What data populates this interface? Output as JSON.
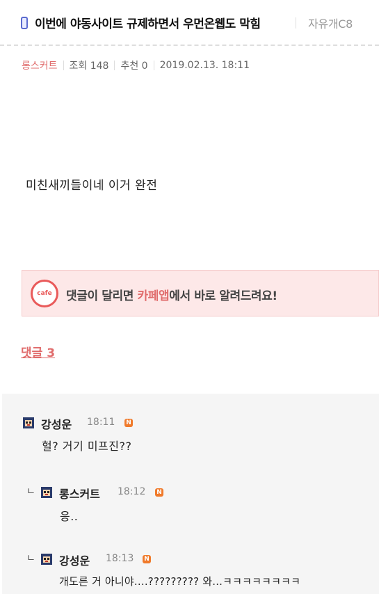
{
  "post": {
    "title": "이번에 야동사이트 규제하면서 우먼온웹도 막힘",
    "board": "자유개C8",
    "author": "롱스커트",
    "views": "조회 148",
    "likes": "추천 0",
    "date": "2019.02.13. 18:11",
    "body": "미친새끼들이네 이거 완전"
  },
  "banner": {
    "logo_text": "cafe",
    "text_pre": "댓글이 달리면 ",
    "text_accent": "카페앱",
    "text_post": "에서 바로 알려드려요!"
  },
  "comments_label": "댓글 3",
  "comments": [
    {
      "author": "강성운",
      "time": "18:11",
      "badge": "N",
      "text": "헐? 거기 미프진??"
    },
    {
      "author": "롱스커트",
      "time": "18:12",
      "badge": "N",
      "text": "응..",
      "reply_mark": "ㄴ"
    },
    {
      "author": "강성운",
      "time": "18:13",
      "badge": "N",
      "text": "개도른 거 아니야....????????? 와...ㅋㅋㅋㅋㅋㅋㅋㅋ",
      "reply_mark": "ㄴ"
    }
  ],
  "colors": {
    "accent": "#e06c6c",
    "badge": "#f07a2b",
    "banner_bg": "#fde8e8"
  },
  "icons": {
    "title_icon": "phone-icon",
    "avatar": "avatar-icon"
  }
}
